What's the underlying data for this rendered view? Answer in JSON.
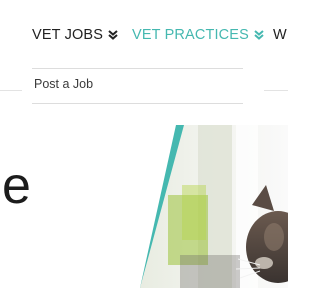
{
  "nav": {
    "vet_jobs": "VET JOBS",
    "vet_practices": "VET PRACTICES",
    "next_item_partial": "W",
    "chevron_icon": "double-chevron-down-icon"
  },
  "dropdown": {
    "items": [
      "Post a Job"
    ]
  },
  "hero": {
    "text_partial": "e",
    "image_subject": "cat-photo"
  },
  "colors": {
    "accent": "#45b8b0",
    "text_dark": "#222222"
  }
}
